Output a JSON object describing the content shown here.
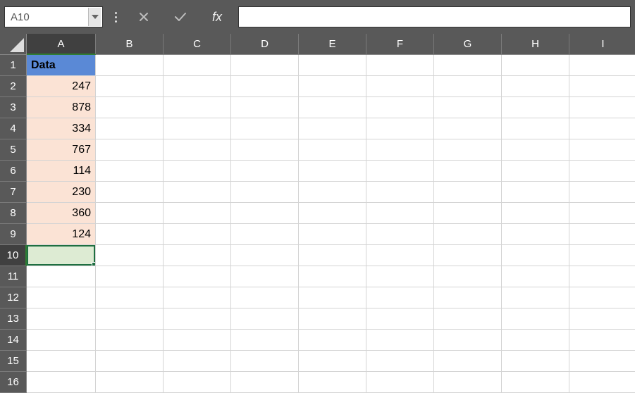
{
  "name_box": {
    "value": "A10"
  },
  "fx_label": "fx",
  "formula_bar": {
    "value": ""
  },
  "columns": [
    "A",
    "B",
    "C",
    "D",
    "E",
    "F",
    "G",
    "H",
    "I"
  ],
  "active_column_index": 0,
  "row_count": 16,
  "active_row": 10,
  "cells": {
    "A1": {
      "value": "Data",
      "style": "header-blue"
    },
    "A2": {
      "value": "247",
      "style": "peach"
    },
    "A3": {
      "value": "878",
      "style": "peach"
    },
    "A4": {
      "value": "334",
      "style": "peach"
    },
    "A5": {
      "value": "767",
      "style": "peach"
    },
    "A6": {
      "value": "114",
      "style": "peach"
    },
    "A7": {
      "value": "230",
      "style": "peach"
    },
    "A8": {
      "value": "360",
      "style": "peach"
    },
    "A9": {
      "value": "124",
      "style": "peach"
    },
    "A10": {
      "value": "",
      "style": "active"
    }
  },
  "chart_data": {
    "type": "table",
    "title": "Data",
    "columns": [
      "Data"
    ],
    "rows": [
      [
        247
      ],
      [
        878
      ],
      [
        334
      ],
      [
        767
      ],
      [
        114
      ],
      [
        230
      ],
      [
        360
      ],
      [
        124
      ]
    ]
  }
}
